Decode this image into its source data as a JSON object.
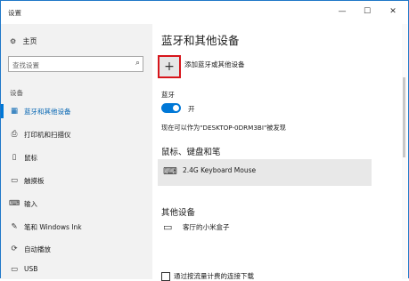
{
  "window": {
    "title": "设置",
    "minimize_glyph": "—",
    "maximize_glyph": "☐",
    "close_glyph": "✕"
  },
  "sidebar": {
    "home_label": "主页",
    "search_placeholder": "查找设置",
    "section_label": "设备",
    "items": [
      {
        "label": "蓝牙和其他设备",
        "icon": "bluetooth-devices-icon",
        "glyph": "▦",
        "active": true
      },
      {
        "label": "打印机和扫描仪",
        "icon": "printer-icon",
        "glyph": "⎙",
        "active": false
      },
      {
        "label": "鼠标",
        "icon": "mouse-icon",
        "glyph": "▯",
        "active": false
      },
      {
        "label": "触摸板",
        "icon": "touchpad-icon",
        "glyph": "▭",
        "active": false
      },
      {
        "label": "输入",
        "icon": "keyboard-icon",
        "glyph": "⌨",
        "active": false
      },
      {
        "label": "笔和 Windows Ink",
        "icon": "pen-icon",
        "glyph": "✎",
        "active": false
      },
      {
        "label": "自动播放",
        "icon": "autoplay-icon",
        "glyph": "⟳",
        "active": false
      },
      {
        "label": "USB",
        "icon": "usb-icon",
        "glyph": "▭",
        "active": false
      }
    ]
  },
  "main": {
    "page_title": "蓝牙和其他设备",
    "add_button_glyph": "+",
    "add_label": "添加蓝牙或其他设备",
    "bluetooth_label": "蓝牙",
    "bluetooth_state": "开",
    "discoverable_text": "现在可以作为\"DESKTOP-0DRM3BI\"被发现",
    "mouse_section_title": "鼠标、键盘和笔",
    "mouse_device": "2.4G Keyboard Mouse",
    "other_section_title": "其他设备",
    "other_device": "客厅的小米盒子",
    "metered_label": "通过按流量计费的连接下载"
  },
  "colors": {
    "accent": "#0078d7",
    "highlight_border": "#d7151b",
    "sidebar_bg": "#f2f2f2"
  }
}
